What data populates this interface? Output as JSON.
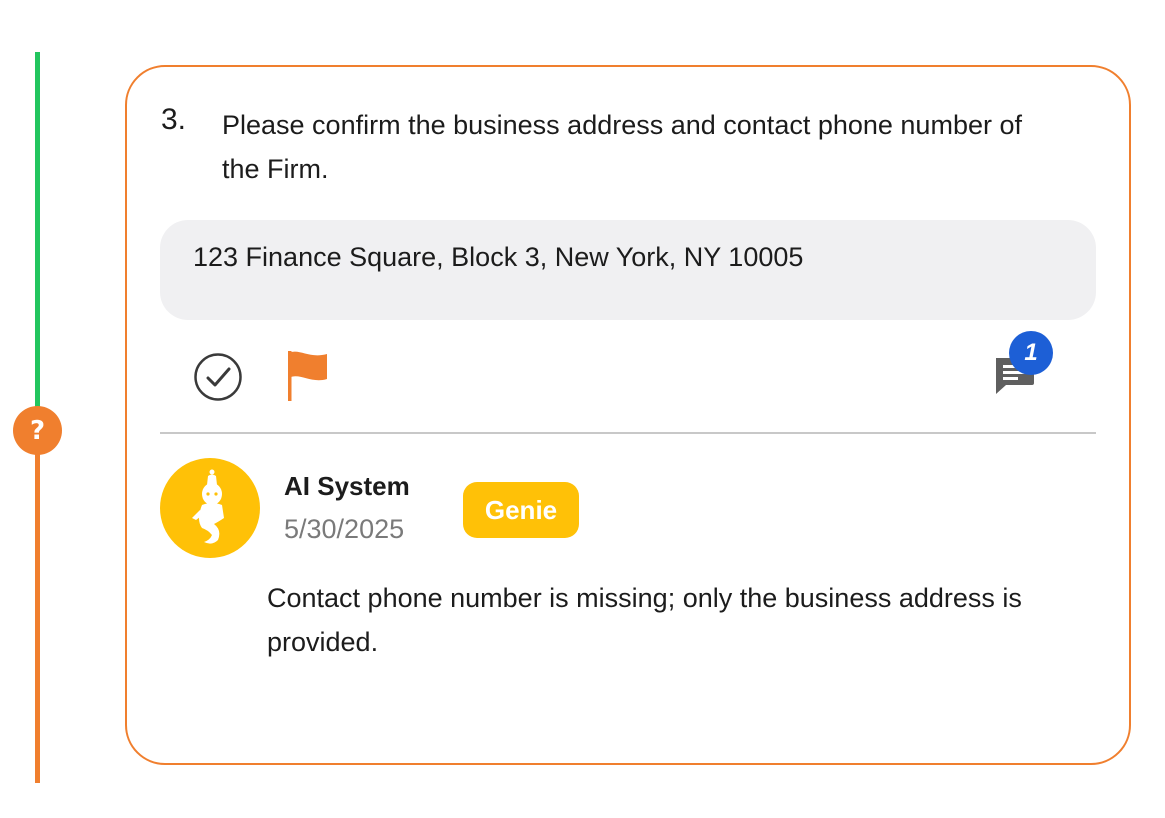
{
  "question": {
    "number": "3.",
    "text": "Please confirm the business address and contact phone number of the Firm."
  },
  "answer": {
    "value": "123 Finance Square, Block 3, New York, NY 10005"
  },
  "status": {
    "symbol": "?",
    "color": "#f07f2e"
  },
  "actions": {
    "comment_count": "1"
  },
  "comment": {
    "author": "AI System",
    "date": "5/30/2025",
    "badge": "Genie",
    "body": "Contact phone number is missing; only the business address is provided."
  },
  "colors": {
    "accent_orange": "#f07f2e",
    "timeline_green": "#22c55e",
    "badge_blue": "#1d5fd6",
    "genie_yellow": "#ffc107",
    "answer_bg": "#f0f0f2"
  },
  "icons": {
    "status": "question-icon",
    "confirm": "check-circle-icon",
    "flag": "flag-icon",
    "comment": "comment-icon",
    "avatar": "genie-icon"
  }
}
